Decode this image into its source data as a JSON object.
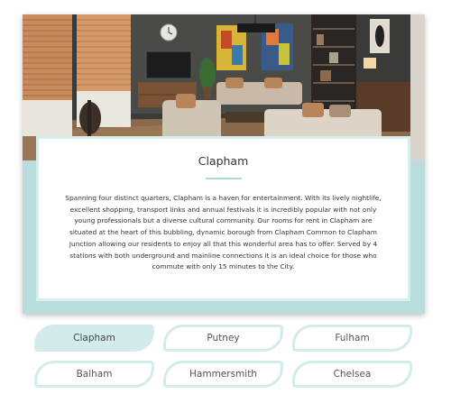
{
  "location": {
    "title": "Clapham",
    "description": "Spanning four distinct quarters, Clapham is a haven for entertainment. With its lively nightlife, excellent shopping, transport links and annual festivals it is incredibly popular with not only young professionals but a diverse cultural community. Our rooms for rent in Clapham are situated at the heart of this bubbling, dynamic borough from Clapham Common to Clapham Junction allowing our residents to enjoy all that this wonderful area has to offer. Served by 4 stations with both underground and mainline connections it is an ideal choice for those who commute with only 15 minutes to the City."
  },
  "tabs": [
    {
      "label": "Clapham",
      "active": true
    },
    {
      "label": "Putney",
      "active": false
    },
    {
      "label": "Fulham",
      "active": false
    },
    {
      "label": "Balham",
      "active": false
    },
    {
      "label": "Hammersmith",
      "active": false
    },
    {
      "label": "Chelsea",
      "active": false
    }
  ],
  "colors": {
    "accent": "#b8dddc",
    "tab_active": "#d2eceb"
  }
}
